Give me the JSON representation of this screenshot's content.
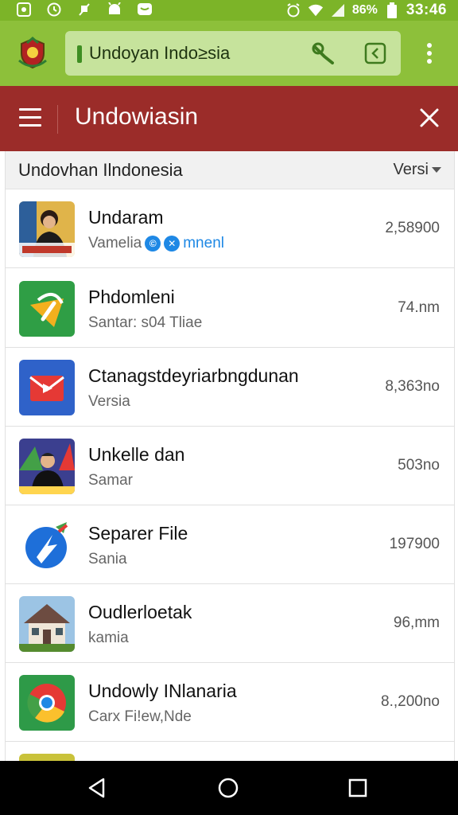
{
  "status_bar": {
    "battery": "86%",
    "time": "33:46",
    "icons": [
      "image-icon",
      "clock-icon",
      "notification-icon",
      "android-icon",
      "message-icon",
      "alarm-icon",
      "wifi-icon",
      "signal-icon",
      "battery-icon"
    ]
  },
  "browser": {
    "url": "Undoyan Indo≥sia",
    "icons": [
      "site-logo-icon",
      "lock-icon",
      "tool-icon",
      "tab-icon",
      "more-vert-icon"
    ]
  },
  "app_header": {
    "title": "Undowiasin",
    "icons": [
      "menu-icon",
      "close-icon"
    ]
  },
  "list": {
    "title": "Undovhan Ilndonesia",
    "sort_label": "Versi",
    "items": [
      {
        "title": "Undaram",
        "subtitle": "Vamelia",
        "subtitle_tail": "mnenl",
        "badges": [
          "©",
          "✕"
        ],
        "value": "2,58900",
        "thumb": "person-thumbnail"
      },
      {
        "title": "Phdomleni",
        "subtitle": "Santar: s04 Tliae",
        "value": "74.nm",
        "thumb": "green-app-icon"
      },
      {
        "title": "Ctanagstdeyriarbngdunan",
        "subtitle": "Versia",
        "value": "8,363no",
        "thumb": "red-mail-icon"
      },
      {
        "title": "Unkelle dan",
        "subtitle": "Samar",
        "value": "503no",
        "thumb": "person-thumbnail"
      },
      {
        "title": "Separer File",
        "subtitle": "Sania",
        "value": "197900",
        "thumb": "blue-swirl-icon"
      },
      {
        "title": "Oudlerloetak",
        "subtitle": "kamia",
        "value": "96,mm",
        "thumb": "house-thumbnail"
      },
      {
        "title": "Undowly INlanaria",
        "subtitle": "Carx Fi!ew,Nde",
        "value": "8.,200no",
        "thumb": "chrome-like-icon"
      }
    ]
  },
  "nav_bar": {
    "icons": [
      "back-icon",
      "home-icon",
      "recents-icon"
    ]
  },
  "colors": {
    "status_green": "#7cb428",
    "browser_green": "#8dc03a",
    "header_red": "#9b2c29"
  }
}
